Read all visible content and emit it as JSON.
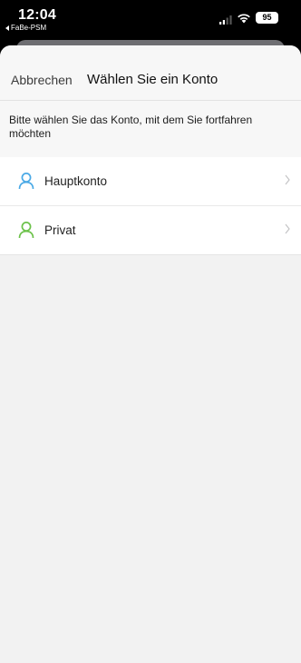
{
  "status_bar": {
    "time": "12:04",
    "back_app": "FaBe-PSM",
    "battery": "95"
  },
  "nav": {
    "cancel_label": "Abbrechen",
    "title": "Wählen Sie ein Konto"
  },
  "prompt": "Bitte wählen Sie das Konto, mit dem Sie fortfahren möchten",
  "accounts": [
    {
      "label": "Hauptkonto",
      "icon": "user-icon",
      "color": "#4aa9e6"
    },
    {
      "label": "Privat",
      "icon": "user-icon",
      "color": "#6cc24a"
    }
  ],
  "colors": {
    "background": "#f2f2f2",
    "row": "#ffffff"
  }
}
